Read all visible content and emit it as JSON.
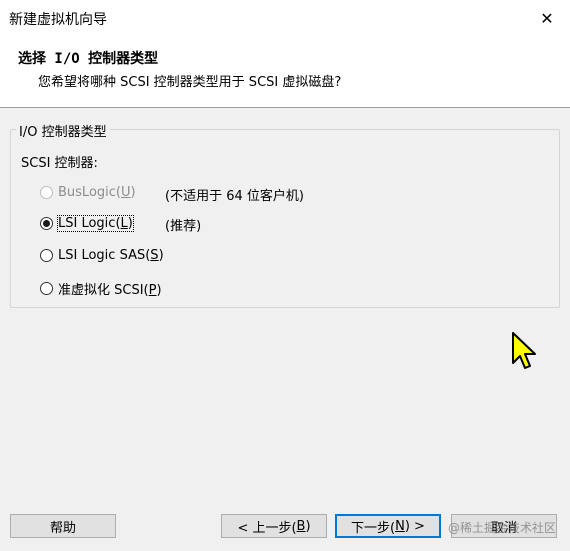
{
  "window": {
    "title": "新建虚拟机向导",
    "close_glyph": "✕"
  },
  "header": {
    "title": "选择 I/O 控制器类型",
    "subtitle": "您希望将哪种 SCSI 控制器类型用于 SCSI 虚拟磁盘?"
  },
  "group": {
    "legend": "I/O 控制器类型",
    "controller_label": "SCSI 控制器:",
    "options": [
      {
        "label": "BusLogic(",
        "mnemonic": "U",
        "suffix": ")",
        "note": "(不适用于 64 位客户机)",
        "checked": false,
        "disabled": true
      },
      {
        "label": "LSI Logic(",
        "mnemonic": "L",
        "suffix": ")",
        "note": "(推荐)",
        "checked": true,
        "disabled": false
      },
      {
        "label": "LSI Logic SAS(",
        "mnemonic": "S",
        "suffix": ")",
        "note": "",
        "checked": false,
        "disabled": false
      },
      {
        "label": "准虚拟化 SCSI(",
        "mnemonic": "P",
        "suffix": ")",
        "note": "",
        "checked": false,
        "disabled": false
      }
    ]
  },
  "buttons": {
    "help": "帮助",
    "back_prefix": "< 上一步(",
    "back_mnemonic": "B",
    "back_suffix": ")",
    "next_prefix": "下一步(",
    "next_mnemonic": "N",
    "next_suffix": ") >",
    "cancel": "取消"
  },
  "watermark": "@稀土掘金技术社区",
  "colors": {
    "cursor_fill": "#ffff00",
    "accent": "#0078d7"
  }
}
